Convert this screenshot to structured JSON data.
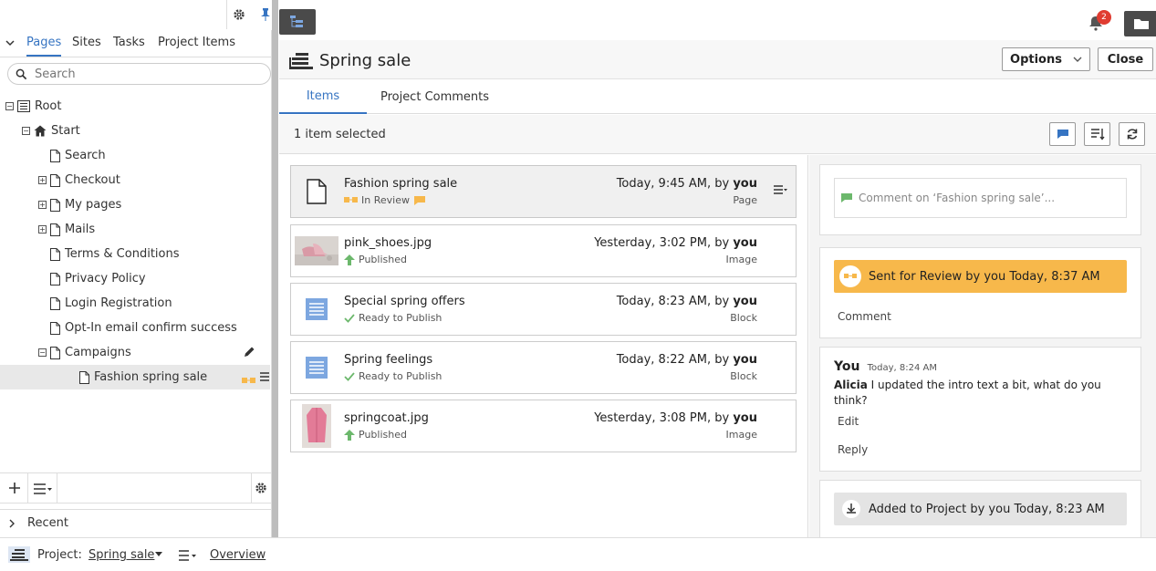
{
  "left": {
    "tabs": [
      "Pages",
      "Sites",
      "Tasks",
      "Project Items"
    ],
    "search_placeholder": "Search",
    "tree": [
      {
        "label": "Root",
        "level": 0,
        "toggle": "minus",
        "icon": "root-icon"
      },
      {
        "label": "Start",
        "level": 1,
        "toggle": "minus",
        "icon": "home-icon"
      },
      {
        "label": "Search",
        "level": 2,
        "toggle": "none",
        "icon": "page-icon"
      },
      {
        "label": "Checkout",
        "level": 2,
        "toggle": "plus",
        "icon": "page-icon"
      },
      {
        "label": "My pages",
        "level": 2,
        "toggle": "plus",
        "icon": "page-icon"
      },
      {
        "label": "Mails",
        "level": 2,
        "toggle": "plus",
        "icon": "page-icon"
      },
      {
        "label": "Terms & Conditions",
        "level": 2,
        "toggle": "none",
        "icon": "page-icon"
      },
      {
        "label": "Privacy Policy",
        "level": 2,
        "toggle": "none",
        "icon": "page-icon"
      },
      {
        "label": "Login Registration",
        "level": 2,
        "toggle": "none",
        "icon": "page-icon"
      },
      {
        "label": "Opt-In email confirm success",
        "level": 2,
        "toggle": "none",
        "icon": "page-icon"
      },
      {
        "label": "Campaigns",
        "level": 2,
        "toggle": "minus",
        "icon": "page-icon"
      },
      {
        "label": "Fashion spring sale",
        "level": 3,
        "toggle": "none",
        "icon": "page-icon",
        "selected": true
      }
    ],
    "recent_label": "Recent"
  },
  "main": {
    "notification_count": "2",
    "title": "Spring sale",
    "options_label": "Options",
    "close_label": "Close",
    "tabs": [
      "Items",
      "Project Comments"
    ],
    "selection_text": "1 item selected",
    "items": [
      {
        "name": "Fashion spring sale",
        "status": "In Review",
        "status_icon": "review-icon",
        "date": "Today, 9:45 AM, by ",
        "by": "you",
        "type": "Page",
        "thumb": "page-icon",
        "selected": true
      },
      {
        "name": "pink_shoes.jpg",
        "status": "Published",
        "status_icon": "published-icon",
        "date": "Yesterday, 3:02 PM, by ",
        "by": "you",
        "type": "Image",
        "thumb": "shoes-image"
      },
      {
        "name": "Special spring offers",
        "status": "Ready to Publish",
        "status_icon": "check-icon",
        "date": "Today, 8:23 AM, by ",
        "by": "you",
        "type": "Block",
        "thumb": "block-icon"
      },
      {
        "name": "Spring feelings",
        "status": "Ready to Publish",
        "status_icon": "check-icon",
        "date": "Today, 8:22 AM, by ",
        "by": "you",
        "type": "Block",
        "thumb": "block-icon"
      },
      {
        "name": "springcoat.jpg",
        "status": "Published",
        "status_icon": "published-icon",
        "date": "Yesterday, 3:08 PM, by ",
        "by": "you",
        "type": "Image",
        "thumb": "coat-image"
      }
    ],
    "comment_placeholder": "Comment on ‘Fashion spring sale’...",
    "review_banner": "Sent for Review by you Today, 8:37 AM",
    "comment_label": "Comment",
    "comment_author": "You",
    "comment_time": "Today, 8:24 AM",
    "comment_mention": "Alicia",
    "comment_text": " I updated the intro text a bit, what do you think?",
    "edit_label": "Edit",
    "reply_label": "Reply",
    "added_banner": "Added to Project by you Today, 8:23 AM"
  },
  "bottom": {
    "project_label": "Project:",
    "project_name": "Spring sale",
    "overview_label": "Overview"
  },
  "colors": {
    "accent": "#3674c2",
    "review": "#f7b84b",
    "published": "#6cb86c",
    "dark_button": "#4a4a4a",
    "badge": "#e03c31"
  }
}
